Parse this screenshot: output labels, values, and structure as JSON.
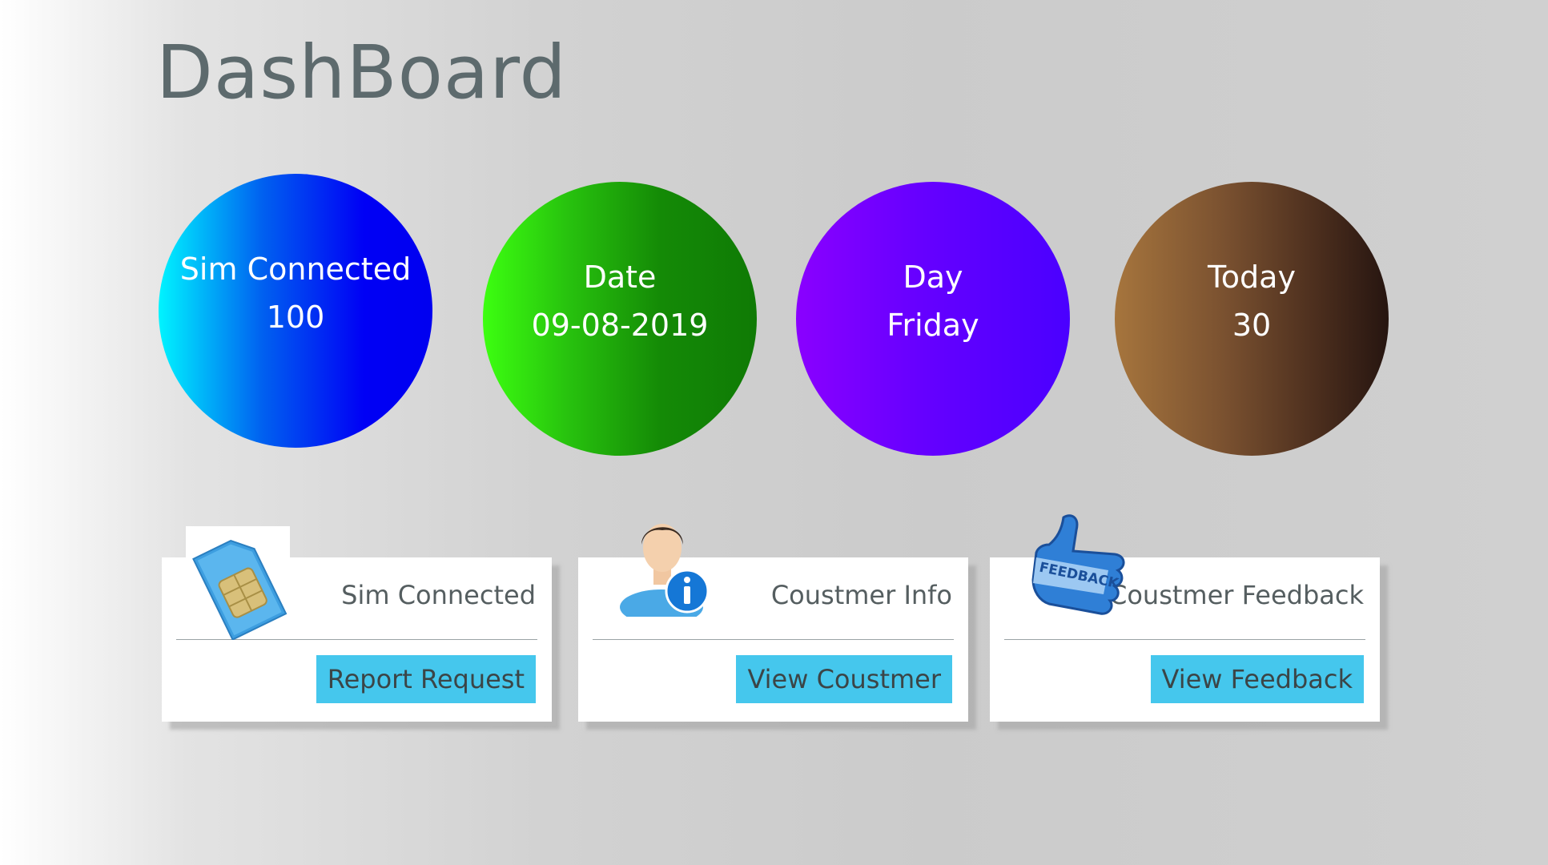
{
  "page": {
    "title": "DashBoard"
  },
  "stats": [
    {
      "label": "Sim Connected",
      "value": "100"
    },
    {
      "label": "Date",
      "value": "09-08-2019"
    },
    {
      "label": "Day",
      "value": "Friday"
    },
    {
      "label": "Today",
      "value": "30"
    }
  ],
  "cards": [
    {
      "icon": "sim-card-icon",
      "label": "Sim Connected",
      "button": "Report Request"
    },
    {
      "icon": "user-info-icon",
      "label": "Coustmer Info",
      "button": "View Coustmer"
    },
    {
      "icon": "feedback-thumbs-up-icon",
      "label": "Coustmer Feedback",
      "button": "View Feedback"
    }
  ],
  "colors": {
    "button": "#45c7ed",
    "title": "#5d6a6d",
    "circle_blue": "#0000f5",
    "circle_green": "#0f7a05",
    "circle_purple": "#6600ff",
    "circle_brown": "#7a5130"
  },
  "icon_text": {
    "feedback_word": "FEEDBACK"
  }
}
